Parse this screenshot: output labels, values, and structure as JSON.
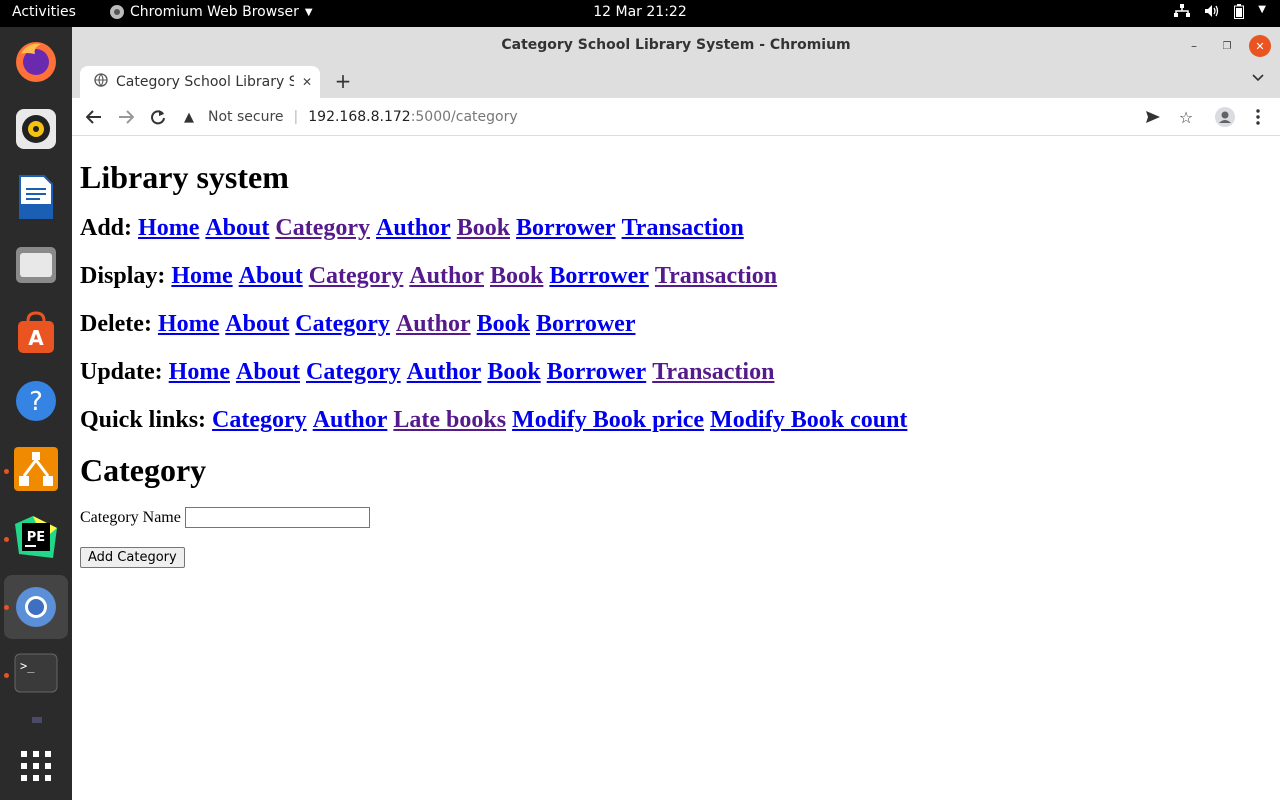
{
  "topbar": {
    "activities": "Activities",
    "app_name": "Chromium Web Browser",
    "clock": "12 Mar  21:22"
  },
  "dock": {
    "items": [
      "firefox-icon",
      "rhythmbox-icon",
      "libreoffice-writer-icon",
      "files-icon",
      "ubuntu-software-icon",
      "help-icon",
      "network-app-icon",
      "pycharm-edu-icon",
      "chromium-icon",
      "terminal-icon",
      "show-apps-icon"
    ]
  },
  "browser": {
    "window_title": "Category School Library System - Chromium",
    "tab_title": "Category School Library System",
    "security_label": "Not secure",
    "url_host": "192.168.8.172",
    "url_path": ":5000/category"
  },
  "page": {
    "heading": "Library system",
    "nav_rows": [
      {
        "label": "Add:",
        "links": [
          "Home",
          "About",
          "Category",
          "Author",
          "Book",
          "Borrower",
          "Transaction"
        ],
        "visited": [
          false,
          false,
          true,
          false,
          true,
          false,
          false
        ]
      },
      {
        "label": "Display:",
        "links": [
          "Home",
          "About",
          "Category",
          "Author",
          "Book",
          "Borrower",
          "Transaction"
        ],
        "visited": [
          false,
          false,
          true,
          true,
          true,
          false,
          true
        ]
      },
      {
        "label": "Delete:",
        "links": [
          "Home",
          "About",
          "Category",
          "Author",
          "Book",
          "Borrower"
        ],
        "visited": [
          false,
          false,
          false,
          true,
          false,
          false
        ]
      },
      {
        "label": "Update:",
        "links": [
          "Home",
          "About",
          "Category",
          "Author",
          "Book",
          "Borrower",
          "Transaction"
        ],
        "visited": [
          false,
          false,
          false,
          false,
          false,
          false,
          true
        ]
      },
      {
        "label": "Quick links:",
        "links": [
          "Category",
          "Author",
          "Late books",
          "Modify Book price",
          "Modify Book count"
        ],
        "visited": [
          false,
          false,
          true,
          false,
          false
        ]
      }
    ],
    "section_heading": "Category",
    "form": {
      "field_label": "Category Name",
      "field_value": "",
      "submit_label": "Add Category"
    }
  },
  "colors": {
    "link": "#0000ee",
    "visited_link": "#551a8b",
    "close_button": "#e95420"
  }
}
